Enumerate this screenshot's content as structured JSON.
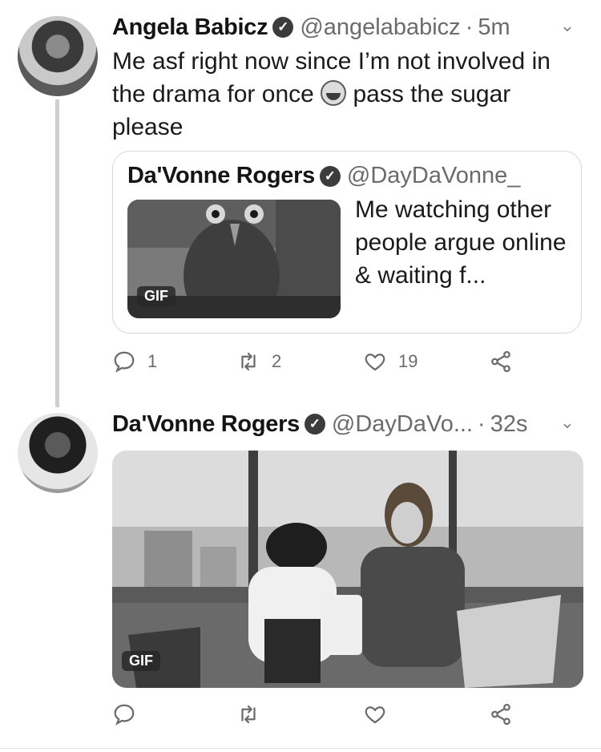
{
  "tweet1": {
    "name": "Angela Babicz",
    "handle": "@angelababicz",
    "time": "5m",
    "text_before_emoji": "Me asf right now since I’m not involved in the drama for once",
    "text_after_emoji": "pass the sugar please",
    "emoji": "grinning-face",
    "quote": {
      "name": "Da'Vonne Rogers",
      "handle": "@DayDaVonne_",
      "text": "Me watching other people argue online & waiting f...",
      "media_badge": "GIF"
    },
    "actions": {
      "reply_count": "1",
      "retweet_count": "2",
      "like_count": "19"
    }
  },
  "tweet2": {
    "name": "Da'Vonne Rogers",
    "handle": "@DayDaVo...",
    "time": "32s",
    "media_badge": "GIF"
  },
  "separator": "·",
  "icons": [
    "verified-icon",
    "chevron-down-icon",
    "reply-icon",
    "retweet-icon",
    "like-icon",
    "share-icon"
  ],
  "colors": {
    "text": "#1a1a1a",
    "muted": "#6b6b6b",
    "border": "#d6d6d6"
  }
}
